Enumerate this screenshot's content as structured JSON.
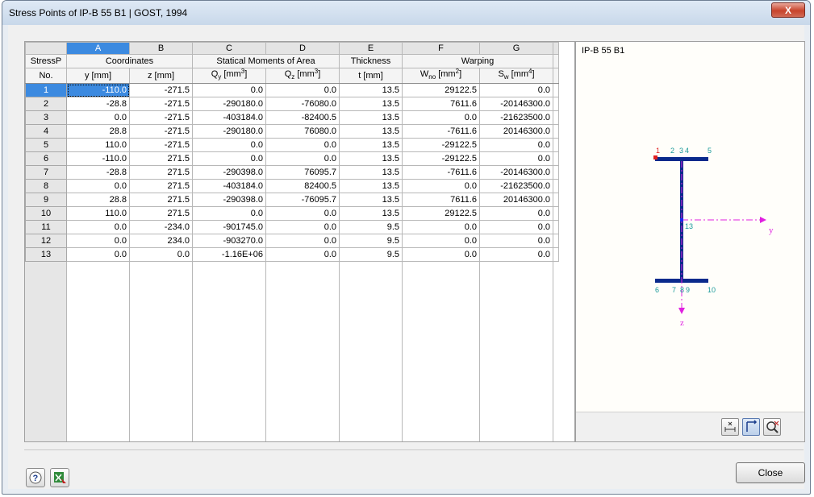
{
  "window": {
    "title": "Stress Points of IP-B 55 B1 | GOST, 1994",
    "close_glyph": "X"
  },
  "table": {
    "column_letters": [
      "A",
      "B",
      "C",
      "D",
      "E",
      "F",
      "G"
    ],
    "row_header": {
      "line1": "StressP",
      "line2": "No."
    },
    "group_headers": {
      "coordinates": "Coordinates",
      "statical_moments": "Statical Moments of Area",
      "thickness": "Thickness",
      "warping": "Warping"
    },
    "unit_headers": {
      "y": "y [mm]",
      "z": "z [mm]",
      "qy": "Q",
      "qy_sub": "y",
      "qy_unit": " [mm",
      "qz": "Q",
      "qz_sub": "z",
      "qz_unit": " [mm",
      "cube": "3",
      "t": "t [mm]",
      "wno": "W",
      "wno_sub": "no",
      "wno_unit": " [mm",
      "square": "2",
      "sw": "S",
      "sw_sub": "w",
      "sw_unit": " [mm",
      "fourth": "4",
      "close_bracket": "]"
    },
    "rows": [
      {
        "no": "1",
        "y": "-110.0",
        "z": "-271.5",
        "qy": "0.0",
        "qz": "0.0",
        "t": "13.5",
        "wno": "29122.5",
        "sw": "0.0"
      },
      {
        "no": "2",
        "y": "-28.8",
        "z": "-271.5",
        "qy": "-290180.0",
        "qz": "-76080.0",
        "t": "13.5",
        "wno": "7611.6",
        "sw": "-20146300.0"
      },
      {
        "no": "3",
        "y": "0.0",
        "z": "-271.5",
        "qy": "-403184.0",
        "qz": "-82400.5",
        "t": "13.5",
        "wno": "0.0",
        "sw": "-21623500.0"
      },
      {
        "no": "4",
        "y": "28.8",
        "z": "-271.5",
        "qy": "-290180.0",
        "qz": "76080.0",
        "t": "13.5",
        "wno": "-7611.6",
        "sw": "20146300.0"
      },
      {
        "no": "5",
        "y": "110.0",
        "z": "-271.5",
        "qy": "0.0",
        "qz": "0.0",
        "t": "13.5",
        "wno": "-29122.5",
        "sw": "0.0"
      },
      {
        "no": "6",
        "y": "-110.0",
        "z": "271.5",
        "qy": "0.0",
        "qz": "0.0",
        "t": "13.5",
        "wno": "-29122.5",
        "sw": "0.0"
      },
      {
        "no": "7",
        "y": "-28.8",
        "z": "271.5",
        "qy": "-290398.0",
        "qz": "76095.7",
        "t": "13.5",
        "wno": "-7611.6",
        "sw": "-20146300.0"
      },
      {
        "no": "8",
        "y": "0.0",
        "z": "271.5",
        "qy": "-403184.0",
        "qz": "82400.5",
        "t": "13.5",
        "wno": "0.0",
        "sw": "-21623500.0"
      },
      {
        "no": "9",
        "y": "28.8",
        "z": "271.5",
        "qy": "-290398.0",
        "qz": "-76095.7",
        "t": "13.5",
        "wno": "7611.6",
        "sw": "20146300.0"
      },
      {
        "no": "10",
        "y": "110.0",
        "z": "271.5",
        "qy": "0.0",
        "qz": "0.0",
        "t": "13.5",
        "wno": "29122.5",
        "sw": "0.0"
      },
      {
        "no": "11",
        "y": "0.0",
        "z": "-234.0",
        "qy": "-901745.0",
        "qz": "0.0",
        "t": "9.5",
        "wno": "0.0",
        "sw": "0.0"
      },
      {
        "no": "12",
        "y": "0.0",
        "z": "234.0",
        "qy": "-903270.0",
        "qz": "0.0",
        "t": "9.5",
        "wno": "0.0",
        "sw": "0.0"
      },
      {
        "no": "13",
        "y": "0.0",
        "z": "0.0",
        "qy": "-1.16E+06",
        "qz": "0.0",
        "t": "9.5",
        "wno": "0.0",
        "sw": "0.0"
      }
    ]
  },
  "graphic": {
    "section_name": "IP-B 55 B1",
    "point_labels": {
      "p1": "1",
      "p2": "2",
      "p3": "3",
      "p4": "4",
      "p5": "5",
      "p6": "6",
      "p7": "7",
      "p8": "8",
      "p9": "9",
      "p10": "10",
      "p13": "13"
    },
    "axis_y": "y",
    "axis_z": "z",
    "colors": {
      "section": "#0a2a8c",
      "axis": "#e020e0",
      "point": "#1a9a9a",
      "selected_point": "#e02020"
    },
    "toolbar_icons": [
      "dimension-icon",
      "axes-icon",
      "reset-view-icon"
    ]
  },
  "footer": {
    "help_icon": "help-icon",
    "excel_icon": "excel-export-icon",
    "close_label": "Close"
  }
}
